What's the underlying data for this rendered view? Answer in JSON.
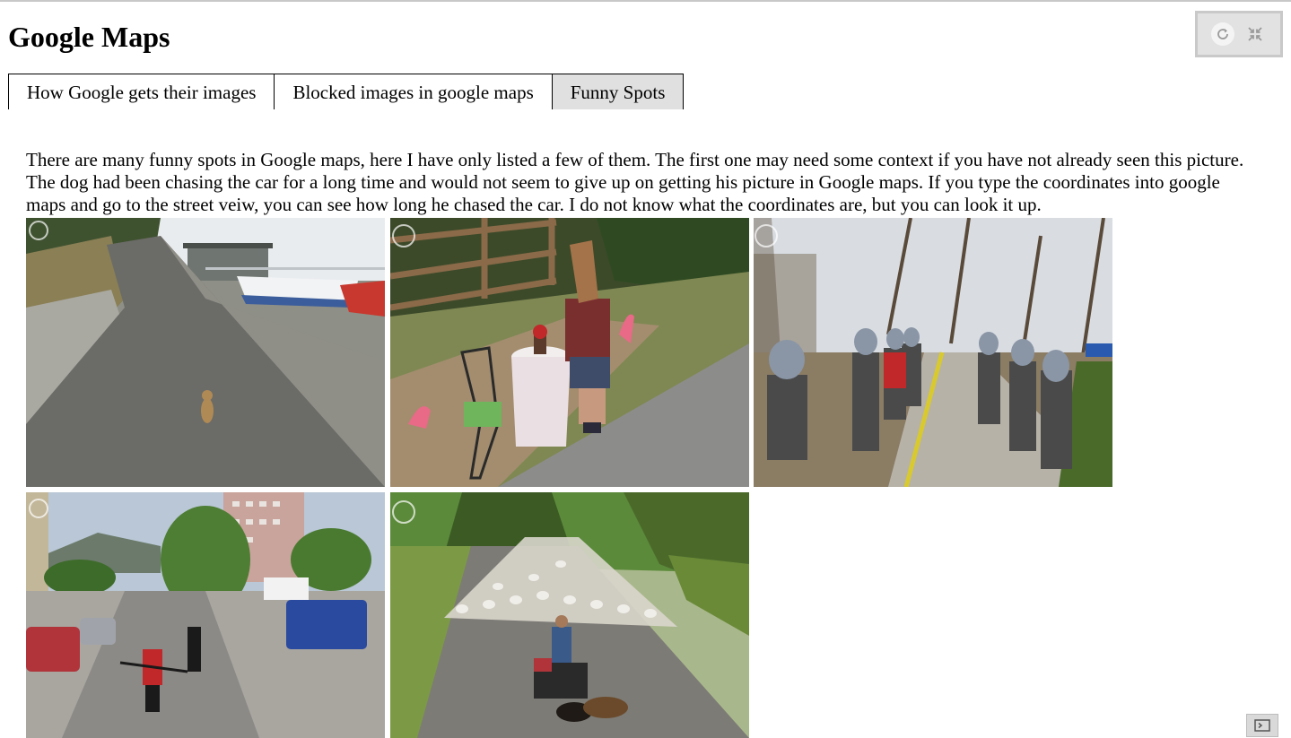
{
  "page": {
    "title": "Google Maps"
  },
  "tabs": [
    {
      "label": "How Google gets their images",
      "active": false
    },
    {
      "label": "Blocked images in google maps",
      "active": false
    },
    {
      "label": "Funny Spots",
      "active": true
    }
  ],
  "controls": {
    "refresh_icon": "refresh-icon",
    "collapse_icon": "collapse-icon"
  },
  "content": {
    "description": "There are many funny spots in Google maps, here I have only listed a few of them. The first one may need some context if you have not already seen this picture. The dog had been chasing the car for a long time and would not seem to give up on getting his picture in Google maps. If you type the coordinates into google maps and go to the street veiw, you can see how long he chased the car. I do not know what the coordinates are, but you can look it up."
  },
  "images": [
    {
      "subject": "dog-chasing-car"
    },
    {
      "subject": "horse-mask-person"
    },
    {
      "subject": "pigeon-mask-people"
    },
    {
      "subject": "street-scene"
    },
    {
      "subject": "sheep-herd"
    }
  ],
  "colors": {
    "active_tab": "#e0e0e0",
    "controls_bg": "#e2e2e2",
    "controls_border": "#c9c9c9"
  },
  "console": {
    "icon": "terminal-icon"
  }
}
